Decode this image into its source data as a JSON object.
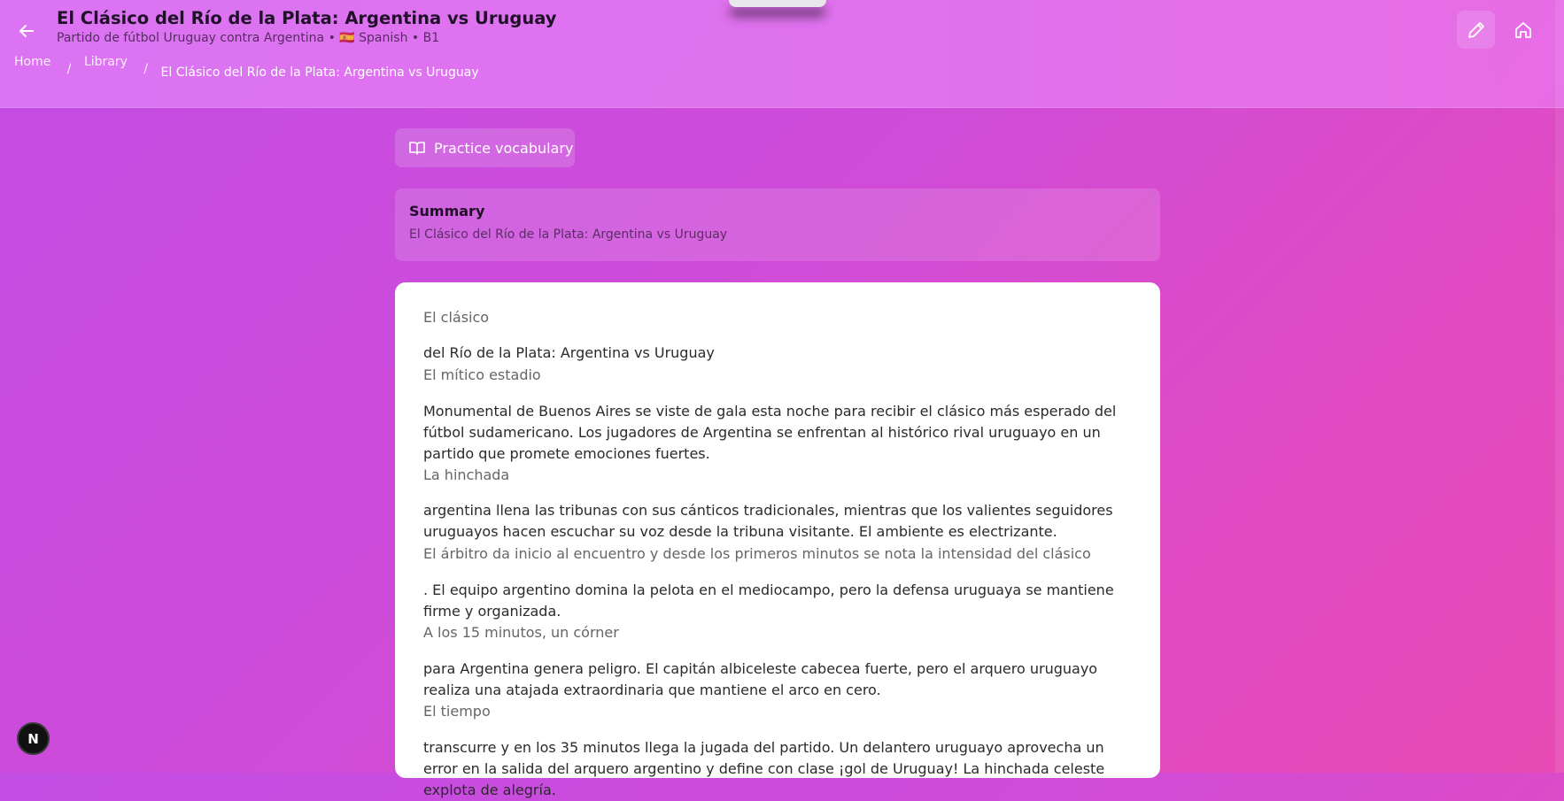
{
  "header": {
    "title": "El Clásico del Río de la Plata: Argentina vs Uruguay",
    "subtitle": "Partido de fútbol Uruguay contra Argentina • 🇪🇸 Spanish • B1"
  },
  "breadcrumb": {
    "home": "Home",
    "library": "Library",
    "current": "El Clásico del Río de la Plata: Argentina vs Uruguay",
    "separator": "/"
  },
  "actions": {
    "practice_label": "Practice vocabulary"
  },
  "summary": {
    "heading": "Summary",
    "text": "El Clásico del Río de la Plata: Argentina vs Uruguay"
  },
  "story": {
    "paragraphs": [
      {
        "lead": "El clásico",
        "body": ""
      },
      {
        "lead": "",
        "body": "del Río de la Plata: Argentina vs Uruguay"
      },
      {
        "lead": "El mítico estadio",
        "body": ""
      },
      {
        "lead": "",
        "body": "Monumental de Buenos Aires se viste de gala esta noche para recibir el clásico más esperado del fútbol sudamericano. Los jugadores de Argentina se enfrentan al histórico rival uruguayo en un partido que promete emociones fuertes."
      },
      {
        "lead": "La hinchada",
        "body": ""
      },
      {
        "lead": "",
        "body": "argentina llena las tribunas con sus cánticos tradicionales, mientras que los valientes seguidores uruguayos hacen escuchar su voz desde la tribuna visitante. El ambiente es electrizante."
      },
      {
        "lead": "El árbitro da inicio al encuentro y desde los primeros minutos se nota la intensidad del clásico",
        "body": ""
      },
      {
        "lead": "",
        "body": ". El equipo argentino domina la pelota en el mediocampo, pero la defensa uruguaya se mantiene firme y organizada."
      },
      {
        "lead": "A los 15 minutos, un córner",
        "body": ""
      },
      {
        "lead": "",
        "body": "para Argentina genera peligro. El capitán albiceleste cabecea fuerte, pero el arquero uruguayo realiza una atajada extraordinaria que mantiene el arco en cero."
      },
      {
        "lead": "El tiempo",
        "body": ""
      },
      {
        "lead": "",
        "body": "transcurre y en los 35 minutos llega la jugada del partido. Un delantero uruguayo aprovecha un error en la salida del arquero argentino y define con clase ¡gol de Uruguay! La hinchada celeste explota de alegría."
      }
    ]
  },
  "avatar": {
    "initial": "N"
  },
  "colors": {
    "accent": "#c24ce4",
    "card": "#ffffff"
  }
}
